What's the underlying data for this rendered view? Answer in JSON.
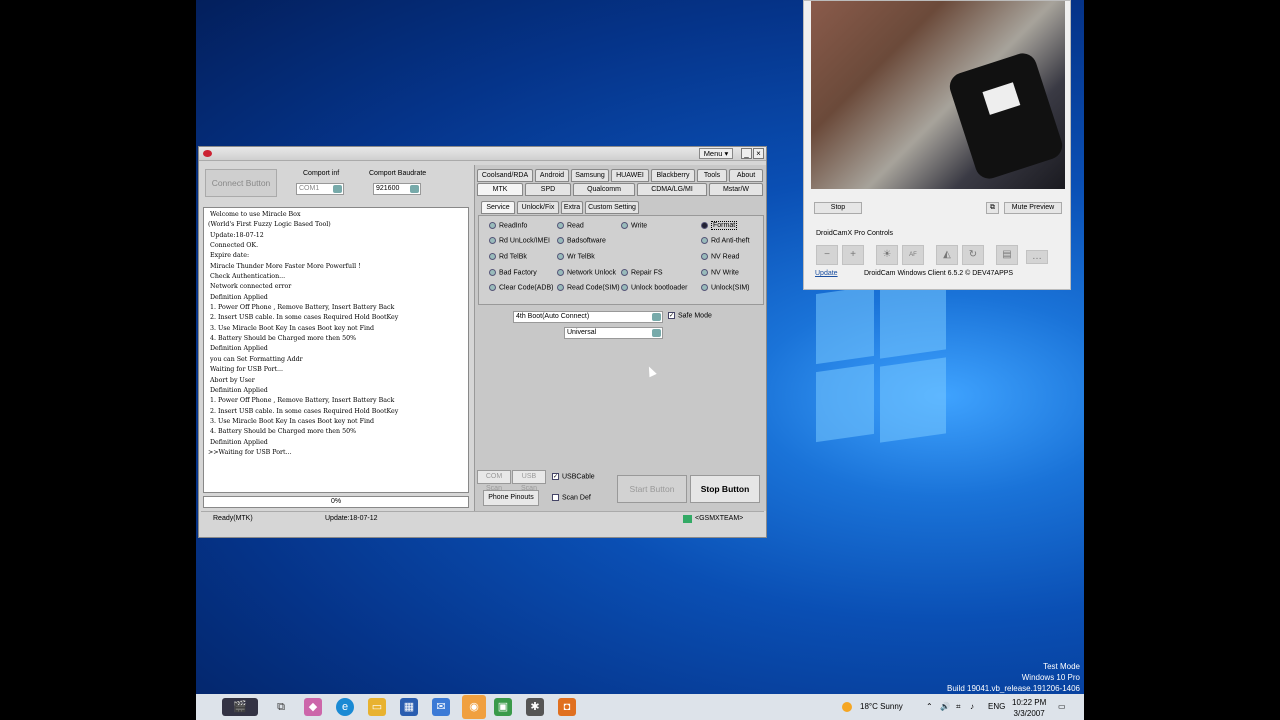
{
  "miracle": {
    "menu_label": "Menu ▾",
    "connect_button": "Connect Button",
    "comport_label": "Comport inf",
    "baud_label": "Comport Baudrate",
    "comport_value": "COM1",
    "baud_value": "921600",
    "log_text": " Welcome to use Miracle Box\n(World's First Fuzzy Logic Based Tool)\n Update:18-07-12\n Connected OK.\n Expire date:\n Miracle Thunder More Faster More Powerfull !\n Check Authentication...\n Network connected error\n Definition Applied\n 1. Power Off Phone , Remove Battery, Insert Battery Back\n 2. Insert USB cable. In some cases Required Hold BootKey\n 3. Use Miracle Boot Key In cases Boot key not Find\n 4. Battery Should be Charged more then 50%\n Definition Applied\n you can Set Formatting Addr\n Waiting for USB Port...\n Abort by User\n Definition Applied\n 1. Power Off Phone , Remove Battery, Insert Battery Back\n 2. Insert USB cable. In some cases Required Hold BootKey\n 3. Use Miracle Boot Key In cases Boot key not Find\n 4. Battery Should be Charged more then 50%\n Definition Applied\n>>Waiting for USB Port...",
    "progress_text": "0%",
    "progress_value": 0,
    "status_left": "Ready(MTK)",
    "status_update": "Update:18-07-12",
    "status_team": "<GSMXTEAM>",
    "tabs_row1": [
      "Coolsand/RDA",
      "Android",
      "Samsung",
      "HUAWEI",
      "Blackberry",
      "Tools",
      "About"
    ],
    "tabs_row2": [
      "MTK",
      "SPD",
      "Qualcomm",
      "CDMA/LG/MI",
      "Mstar/W"
    ],
    "sub_tabs": [
      "Service",
      "Unlock/Fix",
      "Extra",
      "Custom Setting"
    ],
    "options": {
      "readinfo": "ReadInfo",
      "read": "Read",
      "write": "Write",
      "format": "Format",
      "rd_unlock_imei": "Rd UnLock/IMEI",
      "badsoftware": "Badsoftware",
      "rd_antitheft": "Rd Anti-theft",
      "rd_telbk": "Rd TelBk",
      "wr_telbk": "Wr TelBk",
      "nv_read": "NV Read",
      "bad_factory": "Bad Factory",
      "network_unlock": "Network Unlock",
      "repair_fs": "Repair FS",
      "nv_write": "NV Write",
      "clear_code_adb": "Clear Code(ADB)",
      "read_code_sim": "Read Code(SIM)",
      "unlock_bootloader": "Unlock bootloader",
      "unlock_sim": "Unlock(SIM)"
    },
    "boot_select": "4th Boot(Auto Connect)",
    "safe_mode": "Safe Mode",
    "model_select": "Universal",
    "com_scan": "COM Scan",
    "usb_scan": "USB Scan",
    "usb_cable": "USBCable",
    "phone_pinouts": "Phone Pinouts",
    "scan_def": "Scan Def",
    "start_button": "Start Button",
    "stop_button": "Stop Button"
  },
  "droidcam": {
    "stop": "Stop",
    "mute_preview": "Mute Preview",
    "controls_title": "DroidCamX Pro Controls",
    "update_link": "Update",
    "client_text": "DroidCam Windows Client 6.5.2 © DEV47APPS"
  },
  "watermark": {
    "line1": "Test Mode",
    "line2": "Windows 10 Pro",
    "line3": "Build 19041.vb_release.191206-1406"
  },
  "taskbar": {
    "weather": "18°C  Sunny",
    "lang": "ENG",
    "time": "10:22 PM",
    "date": "3/3/2007"
  }
}
